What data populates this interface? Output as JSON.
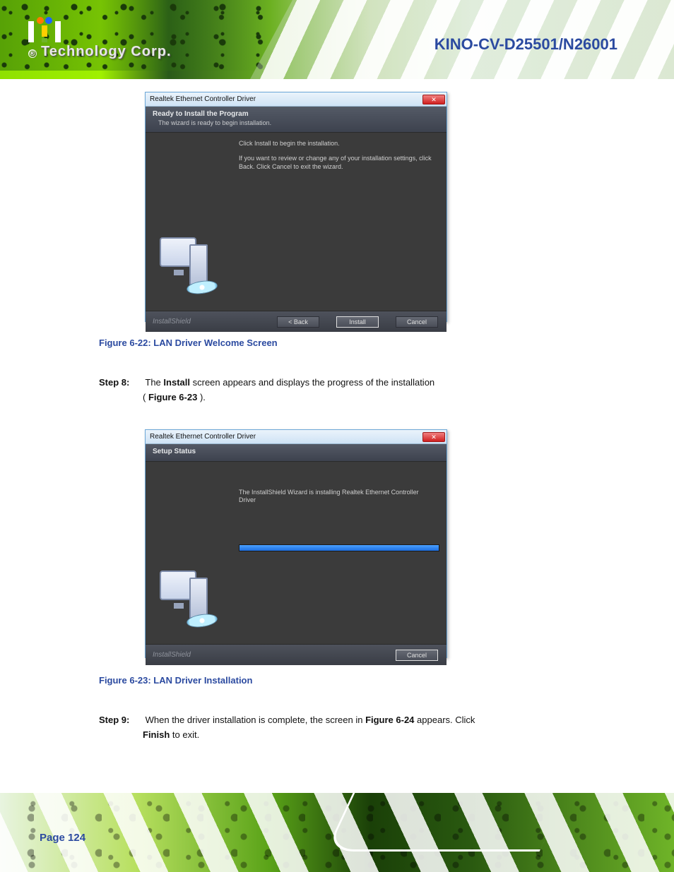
{
  "header": {
    "logo_reg": "®",
    "logo_text": "Technology Corp.",
    "product": "KINO-CV-D25501/N26001"
  },
  "dialog1": {
    "title": "Realtek Ethernet Controller Driver",
    "close_glyph": "✕",
    "heading": "Ready to Install the Program",
    "subheading": "The wizard is ready to begin installation.",
    "line1": "Click Install to begin the installation.",
    "line2": "If you want to review or change any of your installation settings, click Back. Click Cancel to exit the wizard.",
    "brand": "InstallShield",
    "back_label": "< Back",
    "install_label": "Install",
    "cancel_label": "Cancel"
  },
  "caption1": "Figure 6-22: LAN Driver Welcome Screen",
  "step8": {
    "num": "Step 8:",
    "a": "The ",
    "b": "Install",
    "c": " screen appears and displays the progress of the installation",
    "d": "(",
    "e": "Figure 6-23",
    "f": ")."
  },
  "dialog2": {
    "title": "Realtek Ethernet Controller Driver",
    "close_glyph": "✕",
    "heading": "Setup Status",
    "status_line": "The InstallShield Wizard is installing Realtek Ethernet Controller Driver",
    "progress_percent": 100,
    "brand": "InstallShield",
    "cancel_label": "Cancel"
  },
  "caption2": "Figure 6-23: LAN Driver Installation",
  "step9": {
    "num": "Step 9:",
    "a": "When the driver installation is complete, the screen in ",
    "b": "Figure 6-24",
    "c": " appears. Click",
    "d": "Finish",
    "e": " to exit."
  },
  "page_label": "Page 124"
}
